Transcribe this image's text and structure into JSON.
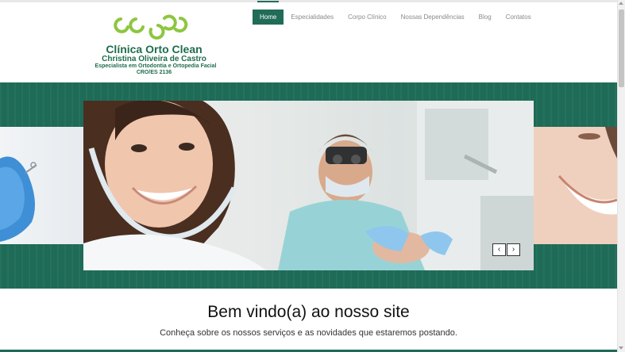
{
  "logo": {
    "name": "Clínica Orto Clean",
    "person": "Christina Oliveira de Castro",
    "specialty": "Especialista em Ortodontia e Ortopedia Facial",
    "registration": "CRO/ES 2136"
  },
  "nav": {
    "items": [
      {
        "label": "Home",
        "active": true
      },
      {
        "label": "Especialidades",
        "active": false
      },
      {
        "label": "Corpo Clínico",
        "active": false
      },
      {
        "label": "Nossas Dependências",
        "active": false
      },
      {
        "label": "Blog",
        "active": false
      },
      {
        "label": "Contatos",
        "active": false
      }
    ]
  },
  "slider": {
    "prev_icon": "chevron-left-icon",
    "next_icon": "chevron-right-icon",
    "prev_glyph": "‹",
    "next_glyph": "›"
  },
  "welcome": {
    "title": "Bem vindo(a) ao nosso site",
    "subtitle": "Conheça sobre os nossos serviços e as novidades que estaremos postando."
  },
  "colors": {
    "accent": "#216c58",
    "logo_green": "#8dc63f",
    "logo_text": "#1f6d4d"
  }
}
